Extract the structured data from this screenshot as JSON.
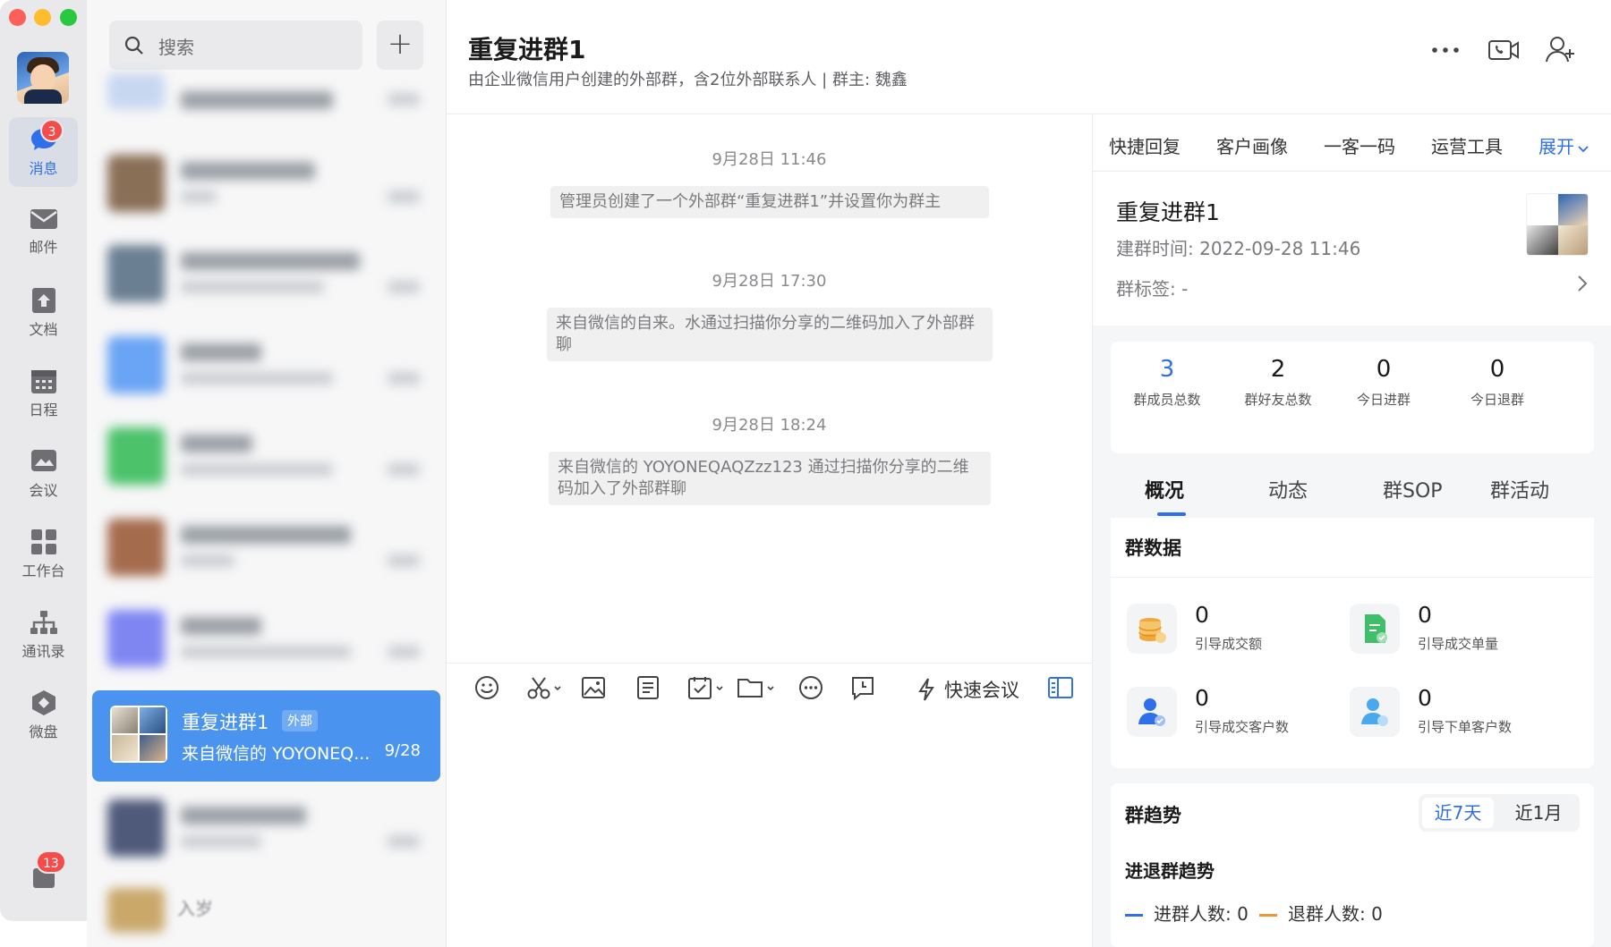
{
  "nav": {
    "items": [
      {
        "label": "消息",
        "icon": "chat-bubble-icon",
        "badge": "3"
      },
      {
        "label": "邮件",
        "icon": "mail-icon"
      },
      {
        "label": "文档",
        "icon": "document-icon"
      },
      {
        "label": "日程",
        "icon": "calendar-icon"
      },
      {
        "label": "会议",
        "icon": "meeting-icon"
      },
      {
        "label": "工作台",
        "icon": "workbench-icon"
      },
      {
        "label": "通讯录",
        "icon": "contacts-icon"
      },
      {
        "label": "微盘",
        "icon": "drive-icon"
      }
    ],
    "bottom_badge": "13"
  },
  "list": {
    "search_placeholder": "搜索",
    "add_label": "+",
    "active_conversation": {
      "title": "重复进群1",
      "tag": "外部",
      "preview": "来自微信的 YOYONEQ...",
      "date": "9/28"
    },
    "bottom_text": "入岁"
  },
  "chat": {
    "title": "重复进群1",
    "subtitle": "由企业微信用户创建的外部群，含2位外部联系人 | 群主: 魏鑫",
    "messages": [
      {
        "time": "9月28日 11:46",
        "text": "管理员创建了一个外部群“重复进群1”并设置你为群主"
      },
      {
        "time": "9月28日 17:30",
        "text": "来自微信的自来。水通过扫描你分享的二维码加入了外部群聊"
      },
      {
        "time": "9月28日 18:24",
        "text": "来自微信的 YOYONEQAQZzz123 通过扫描你分享的二维码加入了外部群聊"
      }
    ],
    "toolbar_meeting": "快速会议"
  },
  "right_panel": {
    "tabs": [
      "快捷回复",
      "客户画像",
      "一客一码",
      "运营工具"
    ],
    "expand_label": "展开",
    "group_name": "重复进群1",
    "created": "建群时间:  2022-09-28 11:46",
    "tag_label": "群标签:  -",
    "stats": [
      {
        "value": "3",
        "label": "群成员总数"
      },
      {
        "value": "2",
        "label": "群好友总数"
      },
      {
        "value": "0",
        "label": "今日进群"
      },
      {
        "value": "0",
        "label": "今日退群"
      }
    ],
    "subtabs": [
      "概况",
      "动态",
      "群SOP",
      "群活动"
    ],
    "group_data_title": "群数据",
    "metrics": [
      {
        "value": "0",
        "label": "引导成交额",
        "icon": "coins-icon"
      },
      {
        "value": "0",
        "label": "引导成交单量",
        "icon": "order-doc-icon"
      },
      {
        "value": "0",
        "label": "引导成交客户数",
        "icon": "customer-check-icon"
      },
      {
        "value": "0",
        "label": "引导下单客户数",
        "icon": "customer-order-icon"
      }
    ],
    "trend_title": "群趋势",
    "range_7": "近7天",
    "range_30": "近1月",
    "trend_sub": "进退群趋势",
    "legend_in": "进群人数: 0",
    "legend_out": "退群人数: 0",
    "colors": {
      "accent": "#2f6fea",
      "legend_in": "#2f6fea",
      "legend_out": "#f0943a"
    }
  }
}
